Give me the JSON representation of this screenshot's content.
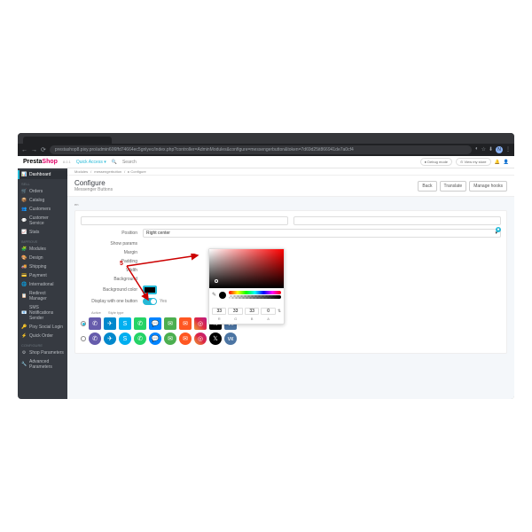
{
  "browser": {
    "url": "prestashop8.pixy.pro/admin606ffd74664ec5gnlyec/index.php?controller=AdminModules&configure=messengerbutton&token=7d69d25it866941de7a0cf4",
    "nav_badge": "N"
  },
  "header": {
    "logo_a": "Presta",
    "logo_b": "Shop",
    "version": "8.0.1",
    "quick_access": "Quick Access ▾",
    "search_placeholder": "Search",
    "debug_mode": "Debug mode",
    "view_store": "View my store"
  },
  "sidebar": {
    "items": [
      {
        "icon": "📊",
        "label": "Dashboard",
        "active": true
      }
    ],
    "sections": [
      {
        "title": "Sell",
        "items": [
          {
            "icon": "🛒",
            "label": "Orders"
          },
          {
            "icon": "📦",
            "label": "Catalog"
          },
          {
            "icon": "👥",
            "label": "Customers"
          },
          {
            "icon": "💬",
            "label": "Customer Service"
          },
          {
            "icon": "📈",
            "label": "Stats"
          }
        ]
      },
      {
        "title": "Improve",
        "items": [
          {
            "icon": "🧩",
            "label": "Modules"
          },
          {
            "icon": "🎨",
            "label": "Design"
          },
          {
            "icon": "🚚",
            "label": "Shipping"
          },
          {
            "icon": "💳",
            "label": "Payment"
          },
          {
            "icon": "🌐",
            "label": "International"
          },
          {
            "icon": "📋",
            "label": "Redirect Manager"
          },
          {
            "icon": "📧",
            "label": "SMS Notifications Sender"
          },
          {
            "icon": "🔑",
            "label": "Pixy Social Login"
          },
          {
            "icon": "⚡",
            "label": "Quick Order"
          }
        ]
      },
      {
        "title": "Configure",
        "items": [
          {
            "icon": "⚙",
            "label": "Shop Parameters"
          },
          {
            "icon": "🔧",
            "label": "Advanced Parameters"
          }
        ]
      }
    ]
  },
  "breadcrumb": {
    "items": [
      "Modules",
      "messengerbutton",
      "▸ Configure"
    ]
  },
  "page": {
    "title": "Configure",
    "subtitle": "Messenger Buttons",
    "btn_back": "Back",
    "btn_translate": "Translate",
    "btn_hooks": "Manage hooks"
  },
  "tabs": {
    "current": "en"
  },
  "form": {
    "position_label": "Position",
    "position_value": "Right center",
    "params_label": "Show params",
    "margin_label": "Margin",
    "padding_label": "Padding",
    "width_label": "Width",
    "bgcolor1_label": "Background",
    "bgcolor2_label": "Background color",
    "display_one_label": "Display with one button",
    "yes": "Yes"
  },
  "colorpicker": {
    "r": "33",
    "g": "33",
    "b": "33",
    "a": "0",
    "label_r": "R",
    "label_g": "G",
    "label_b": "B",
    "label_a": "A"
  },
  "annotation": {
    "step": "5"
  },
  "icons_section": {
    "header_active": "Active",
    "header_type": "Style type",
    "socials": [
      {
        "bg": "#665CAC",
        "char": "✆"
      },
      {
        "bg": "#0088cc",
        "char": "✈"
      },
      {
        "bg": "#00AFF0",
        "char": "S"
      },
      {
        "bg": "#25D366",
        "char": "✆"
      },
      {
        "bg": "#0084FF",
        "char": "💬"
      },
      {
        "bg": "#4CAF50",
        "char": "✉"
      },
      {
        "bg": "#FF5722",
        "char": "✉"
      },
      {
        "bg": "linear-gradient(45deg,#f09433,#e6683c,#dc2743,#cc2366,#bc1888)",
        "char": "◎"
      },
      {
        "bg": "#000000",
        "char": "𝕏"
      },
      {
        "bg": "#4C75A3",
        "char": "vк"
      }
    ]
  }
}
